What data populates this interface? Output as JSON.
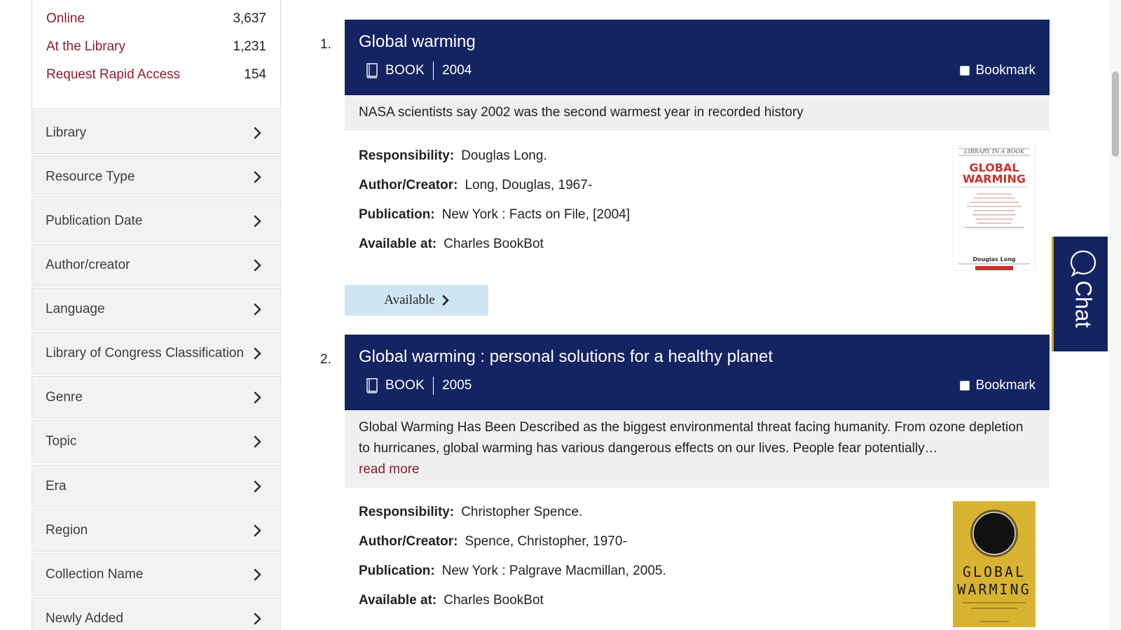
{
  "sidebar": {
    "availability": [
      {
        "label": "Online",
        "count": "3,637"
      },
      {
        "label": "At the Library",
        "count": "1,231"
      },
      {
        "label": "Request Rapid Access",
        "count": "154"
      }
    ],
    "facets": [
      {
        "label": "Library"
      },
      {
        "label": "Resource Type"
      },
      {
        "label": "Publication Date"
      },
      {
        "label": "Author/creator"
      },
      {
        "label": "Language"
      },
      {
        "label": "Library of Congress Classification"
      },
      {
        "label": "Genre"
      },
      {
        "label": "Topic"
      },
      {
        "label": "Era"
      },
      {
        "label": "Region"
      },
      {
        "label": "Collection Name"
      },
      {
        "label": "Newly Added"
      }
    ]
  },
  "results": [
    {
      "number": "1.",
      "title": "Global warming",
      "type": "BOOK",
      "year": "2004",
      "bookmark_label": "Bookmark",
      "summary": "NASA scientists say 2002 was the second warmest year in recorded history",
      "responsibility_label": "Responsibility:",
      "responsibility": "Douglas Long.",
      "author_label": "Author/Creator:",
      "author": "Long, Douglas, 1967-",
      "publication_label": "Publication:",
      "publication": "New York : Facts on File, [2004]",
      "available_at_label": "Available at:",
      "available_at": "Charles BookBot",
      "availability_button": "Available",
      "cover": {
        "series": "LIBRARY IN A BOOK",
        "title_line1": "GLOBAL",
        "title_line2": "WARMING",
        "author": "Douglas Long"
      }
    },
    {
      "number": "2.",
      "title": "Global warming : personal solutions for a healthy planet",
      "type": "BOOK",
      "year": "2005",
      "bookmark_label": "Bookmark",
      "summary": "Global Warming Has Been Described as the biggest environmental threat facing humanity. From ozone depletion to hurricanes, global warming has various dangerous effects on our lives. People fear potentially…",
      "read_more": "read more",
      "responsibility_label": "Responsibility:",
      "responsibility": "Christopher Spence.",
      "author_label": "Author/Creator:",
      "author": "Spence, Christopher, 1970-",
      "publication_label": "Publication:",
      "publication": "New York : Palgrave Macmillan, 2005.",
      "available_at_label": "Available at:",
      "available_at": "Charles BookBot",
      "cover": {
        "title_line1": "GLOBAL",
        "title_line2": "WARMING"
      }
    }
  ],
  "chat": {
    "label": "Chat"
  },
  "colors": {
    "header": "#142462",
    "link": "#8b1d2c",
    "available_button": "#cfe6f2",
    "summary_bg": "#efefef"
  }
}
